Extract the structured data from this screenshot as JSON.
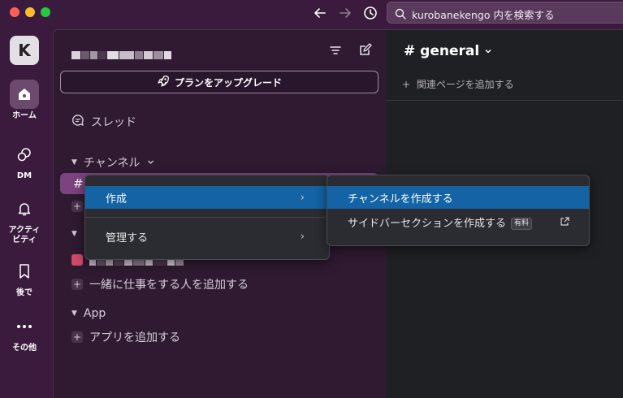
{
  "titlebar": {
    "search_text": "kurobanekengo 内を検索する"
  },
  "rail": {
    "workspace_initial": "K",
    "items": [
      {
        "label": "ホーム",
        "icon": "home-icon"
      },
      {
        "label": "DM",
        "icon": "dm-icon"
      },
      {
        "label": "アクティ\nビティ",
        "icon": "bell-icon"
      },
      {
        "label": "後で",
        "icon": "bookmark-icon"
      },
      {
        "label": "その他",
        "icon": "more-icon"
      }
    ]
  },
  "sidebar": {
    "upgrade_label": "プランをアップグレード",
    "threads_label": "スレッド",
    "channels_section": "チャンネル",
    "add_teammates_label": "一緒に仕事をする人を追加する",
    "app_section": "App",
    "add_apps_label": "アプリを追加する"
  },
  "main": {
    "channel_name": "# general",
    "add_bookmark_label": "関連ページを追加する"
  },
  "context_menu": {
    "items": [
      {
        "label": "作成",
        "has_submenu": true,
        "highlighted": true
      },
      {
        "label": "管理する",
        "has_submenu": true,
        "highlighted": false
      }
    ]
  },
  "submenu": {
    "items": [
      {
        "label": "チャンネルを作成する",
        "highlighted": true
      },
      {
        "label": "サイドバーセクションを作成する",
        "badge": "有料",
        "icon": "external-link-icon"
      }
    ]
  },
  "colors": {
    "sidebar_bg": "#2f1a31",
    "active_channel": "#7b4481",
    "menu_highlight": "#1464a5"
  }
}
